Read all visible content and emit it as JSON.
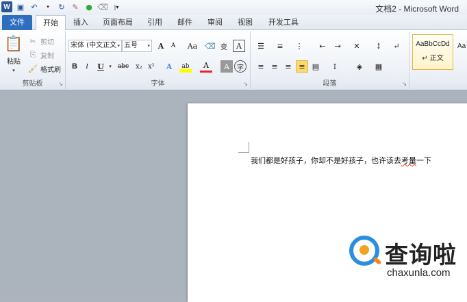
{
  "window": {
    "title": "文档2 - Microsoft Word"
  },
  "qat": {
    "app_icon": "W"
  },
  "tabs": [
    {
      "label": "文件"
    },
    {
      "label": "开始"
    },
    {
      "label": "插入"
    },
    {
      "label": "页面布局"
    },
    {
      "label": "引用"
    },
    {
      "label": "邮件"
    },
    {
      "label": "审阅"
    },
    {
      "label": "视图"
    },
    {
      "label": "开发工具"
    }
  ],
  "ribbon": {
    "clipboard": {
      "label": "剪贴板",
      "paste": "粘贴",
      "cut": "剪切",
      "copy": "复制",
      "format_painter": "格式刷"
    },
    "font": {
      "label": "字体",
      "font_name": "宋体 (中文正文",
      "font_size": "五号",
      "grow": "A",
      "shrink": "A",
      "case": "Aa",
      "bold": "B",
      "italic": "I",
      "underline": "U",
      "strike": "abc",
      "subscript": "x₂",
      "superscript": "x²",
      "text_effect": "A",
      "highlight": "ab",
      "font_color": "A",
      "char_shading": "A",
      "enclose": "字",
      "phonetic": "变",
      "border": "A"
    },
    "paragraph": {
      "label": "段落"
    },
    "styles": {
      "card1_sample": "AaBbCcDd",
      "card1_name": "↵ 正文",
      "card2_sample": "Aa"
    }
  },
  "document": {
    "text_pre": "我们都是好孩子，你却不是好孩子，也许该去",
    "text_err": "考量",
    "text_post": "一下"
  },
  "watermark": {
    "brand": "查询啦",
    "domain": "chaxunla.com"
  }
}
